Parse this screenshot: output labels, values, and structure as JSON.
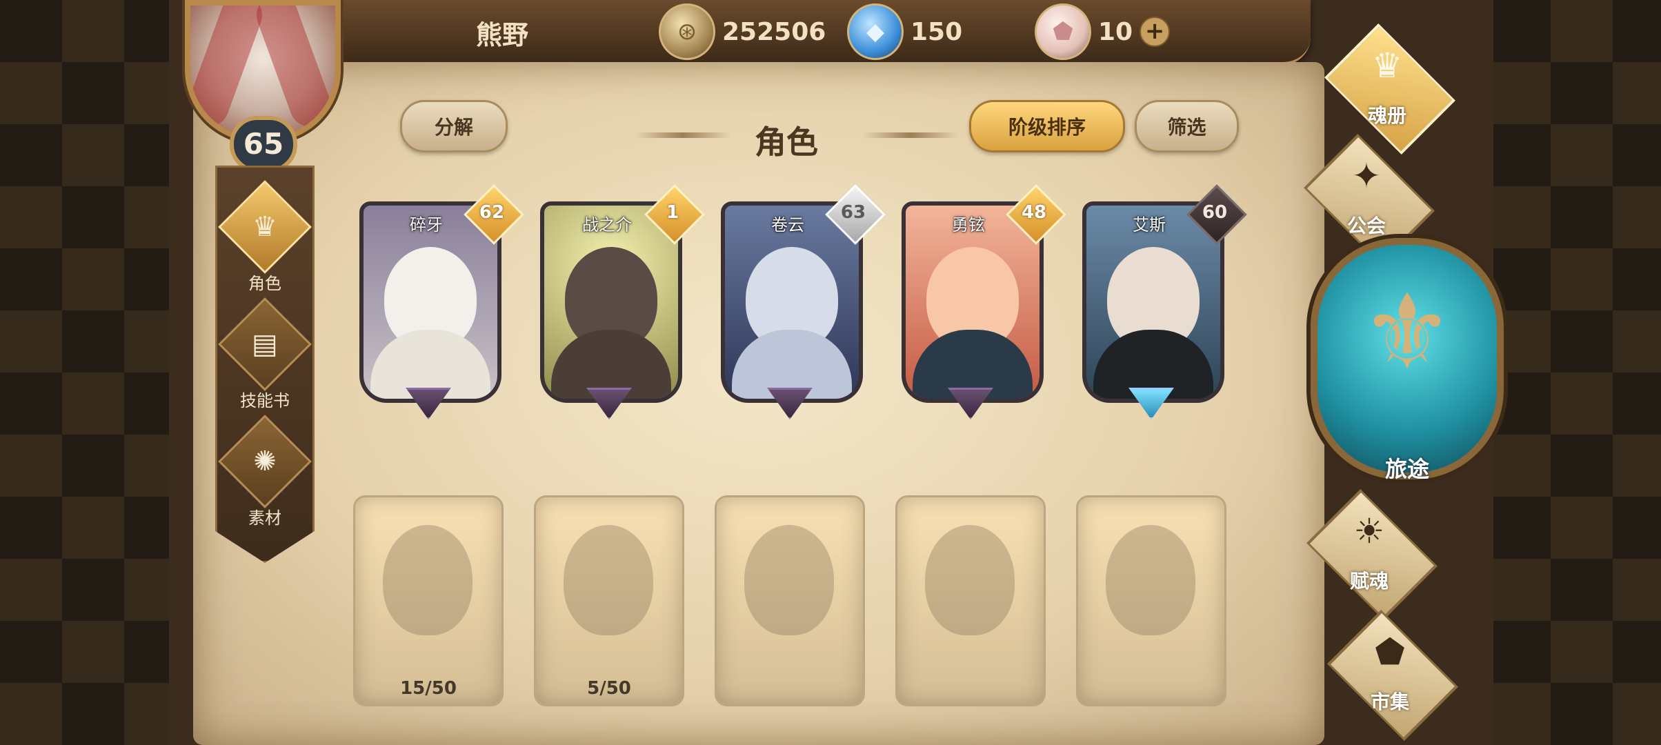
{
  "player": {
    "name": "熊野",
    "level": "65"
  },
  "resources": [
    {
      "icon": "gold-coin-icon",
      "value": "252506"
    },
    {
      "icon": "blue-crystal-icon",
      "value": "150"
    },
    {
      "icon": "pink-gem-icon",
      "value": "10"
    }
  ],
  "left_menu": [
    {
      "label": "角色",
      "icon": "helmet-icon",
      "active": true
    },
    {
      "label": "技能书",
      "icon": "skill-book-icon",
      "active": false
    },
    {
      "label": "素材",
      "icon": "material-icon",
      "active": false
    }
  ],
  "panel": {
    "title": "角色",
    "decompose_label": "分解",
    "sort_label": "阶级排序",
    "filter_label": "筛选"
  },
  "characters": [
    {
      "name": "碎牙",
      "level": "62"
    },
    {
      "name": "战之介",
      "level": "1"
    },
    {
      "name": "卷云",
      "level": "63"
    },
    {
      "name": "勇铉",
      "level": "48"
    },
    {
      "name": "艾斯",
      "level": "60"
    }
  ],
  "locked_characters": [
    {
      "shards": "15/50"
    },
    {
      "shards": "5/50"
    },
    {
      "shards": ""
    },
    {
      "shards": ""
    },
    {
      "shards": ""
    }
  ],
  "right_menu": [
    {
      "label": "魂册",
      "icon": "helmet-icon",
      "active": true
    },
    {
      "label": "公会",
      "icon": "guild-emblem-icon",
      "active": false
    },
    {
      "label": "旅途",
      "icon": "journey-emblem-icon",
      "active": false
    },
    {
      "label": "赋魂",
      "icon": "flame-icon",
      "active": false
    },
    {
      "label": "市集",
      "icon": "market-gem-icon",
      "active": false
    }
  ],
  "colors": {
    "accent_gold": "#e6b04c",
    "parchment": "#efe0c0",
    "frame_brown": "#3b2c1d",
    "journey_teal": "#2fb5c4"
  }
}
